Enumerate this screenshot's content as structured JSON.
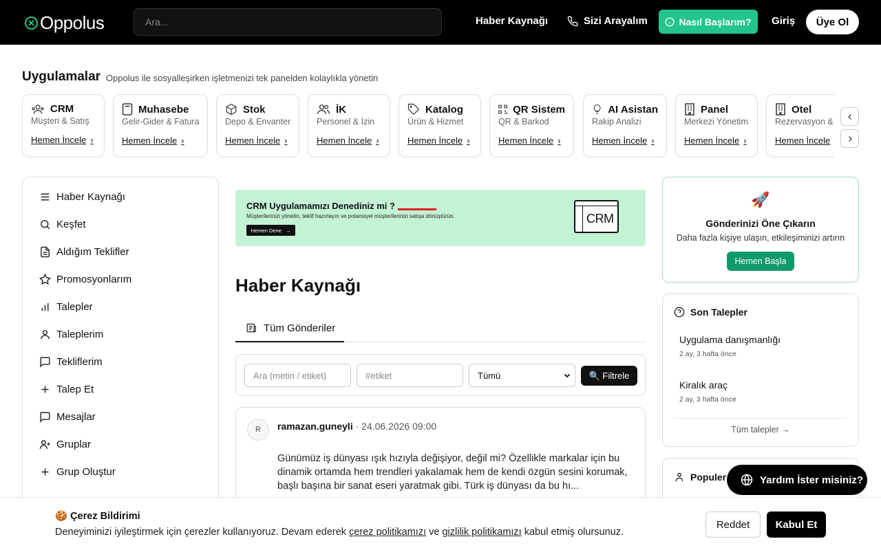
{
  "header": {
    "logo": "Oppolus",
    "search_placeholder": "Ara...",
    "nav": {
      "feed": "Haber Kaynağı",
      "call": "Sizi Arayalım",
      "start": "Nasıl Başlarım?",
      "login": "Giriş",
      "signup": "Üye Ol"
    }
  },
  "apps": {
    "title": "Uygulamalar",
    "subtitle": "Oppolus ile sosyalleşirken işletmenizi tek panelden kolaylıkla yönetin",
    "cards": [
      {
        "name": "CRM",
        "sub": "Müşteri & Satış",
        "link": "Hemen İncele",
        "icon": "users-icon"
      },
      {
        "name": "Muhasebe",
        "sub": "Gelir-Gider & Fatura",
        "link": "Hemen İncele",
        "icon": "calculator-icon"
      },
      {
        "name": "Stok",
        "sub": "Depo & Envanter",
        "link": "Hemen İncele",
        "icon": "box-icon"
      },
      {
        "name": "İK",
        "sub": "Personel & İzin",
        "link": "Hemen İncele",
        "icon": "people-icon"
      },
      {
        "name": "Katalog",
        "sub": "Ürün & Hizmet",
        "link": "Hemen İncele",
        "icon": "tag-icon"
      },
      {
        "name": "QR Sistem",
        "sub": "QR & Barkod",
        "link": "Hemen İncele",
        "icon": "qr-icon"
      },
      {
        "name": "AI Asistan",
        "sub": "Rakip Analizi",
        "link": "Hemen İncele",
        "icon": "bulb-icon"
      },
      {
        "name": "Panel",
        "sub": "Merkezi Yönetim",
        "link": "Hemen İncele",
        "icon": "building-icon"
      },
      {
        "name": "Otel",
        "sub": "Rezervasyon &",
        "link": "Hemen İncele",
        "icon": "hotel-icon"
      }
    ]
  },
  "sidebar": {
    "items": [
      {
        "label": "Haber Kaynağı",
        "icon": "menu-icon"
      },
      {
        "label": "Keşfet",
        "icon": "search-icon"
      },
      {
        "label": "Aldığım Teklifler",
        "icon": "document-icon"
      },
      {
        "label": "Promosyonlarım",
        "icon": "star-icon"
      },
      {
        "label": "Talepler",
        "icon": "bar-chart-icon"
      },
      {
        "label": "Taleplerim",
        "icon": "user-icon"
      },
      {
        "label": "Tekliflerim",
        "icon": "message-icon"
      },
      {
        "label": "Talep Et",
        "icon": "plus-icon"
      },
      {
        "label": "Mesajlar",
        "icon": "chat-icon"
      },
      {
        "label": "Gruplar",
        "icon": "user-plus-icon"
      },
      {
        "label": "Grup Oluştur",
        "icon": "plus-icon"
      }
    ]
  },
  "banner": {
    "title": "CRM Uygulamamızı Denediniz mi ?",
    "desc": "Müşterilerinizi yönetin, teklif hazırlayın ve potansiyel müşterilerinizi satışa dönüştürün.",
    "button": "Hemen Dene",
    "badge": "CRM"
  },
  "feed": {
    "title": "Haber Kaynağı",
    "tab": "Tüm Gönderiler",
    "filter": {
      "search_placeholder": "Ara (metin / etiket)",
      "tag_placeholder": "#etiket",
      "select_value": "Tümü",
      "button": "🔍 Filtrele"
    },
    "post": {
      "avatar": "R",
      "author": "ramazan.guneyli",
      "separator": "·",
      "date": "24.06.2026 09:00",
      "text": "Günümüz iş dünyası ışık hızıyla değişiyor, değil mi? Özellikle markalar için bu dinamik ortamda hem trendleri yakalamak hem de kendi özgün sesini korumak, başlı başına bir sanat eseri yaratmak gibi. Türk iş dünyası da bu hı..."
    }
  },
  "promo": {
    "emoji": "🚀",
    "title": "Gönderinizi Öne Çıkarın",
    "desc": "Daha fazla kişiye ulaşın, etkileşiminizi artırın",
    "button": "Hemen Başla"
  },
  "requests": {
    "title": "Son Talepler",
    "items": [
      {
        "title": "Uygulama danışmanlığı",
        "time": "2 ay, 3 hafta önce"
      },
      {
        "title": "Kiralık araç",
        "time": "2 ay, 3 hafta önce"
      }
    ],
    "all_link": "Tüm talepler →"
  },
  "popular": {
    "title": "Populer"
  },
  "help": {
    "label": "Yardım İster misiniz?"
  },
  "cookie": {
    "title": "🍪 Çerez Bildirimi",
    "text_1": "Deneyiminizi iyileştirmek için çerezler kullanıyoruz. Devam ederek ",
    "link_1": "çerez politikamızı",
    "text_2": " ve ",
    "link_2": "gizlilik politikamızı",
    "text_3": " kabul etmiş olursunuz.",
    "reject": "Reddet",
    "accept": "Kabul Et"
  },
  "colors": {
    "brand": "#22c58b",
    "banner_bg": "#c4f2d4",
    "dark": "#000000"
  }
}
